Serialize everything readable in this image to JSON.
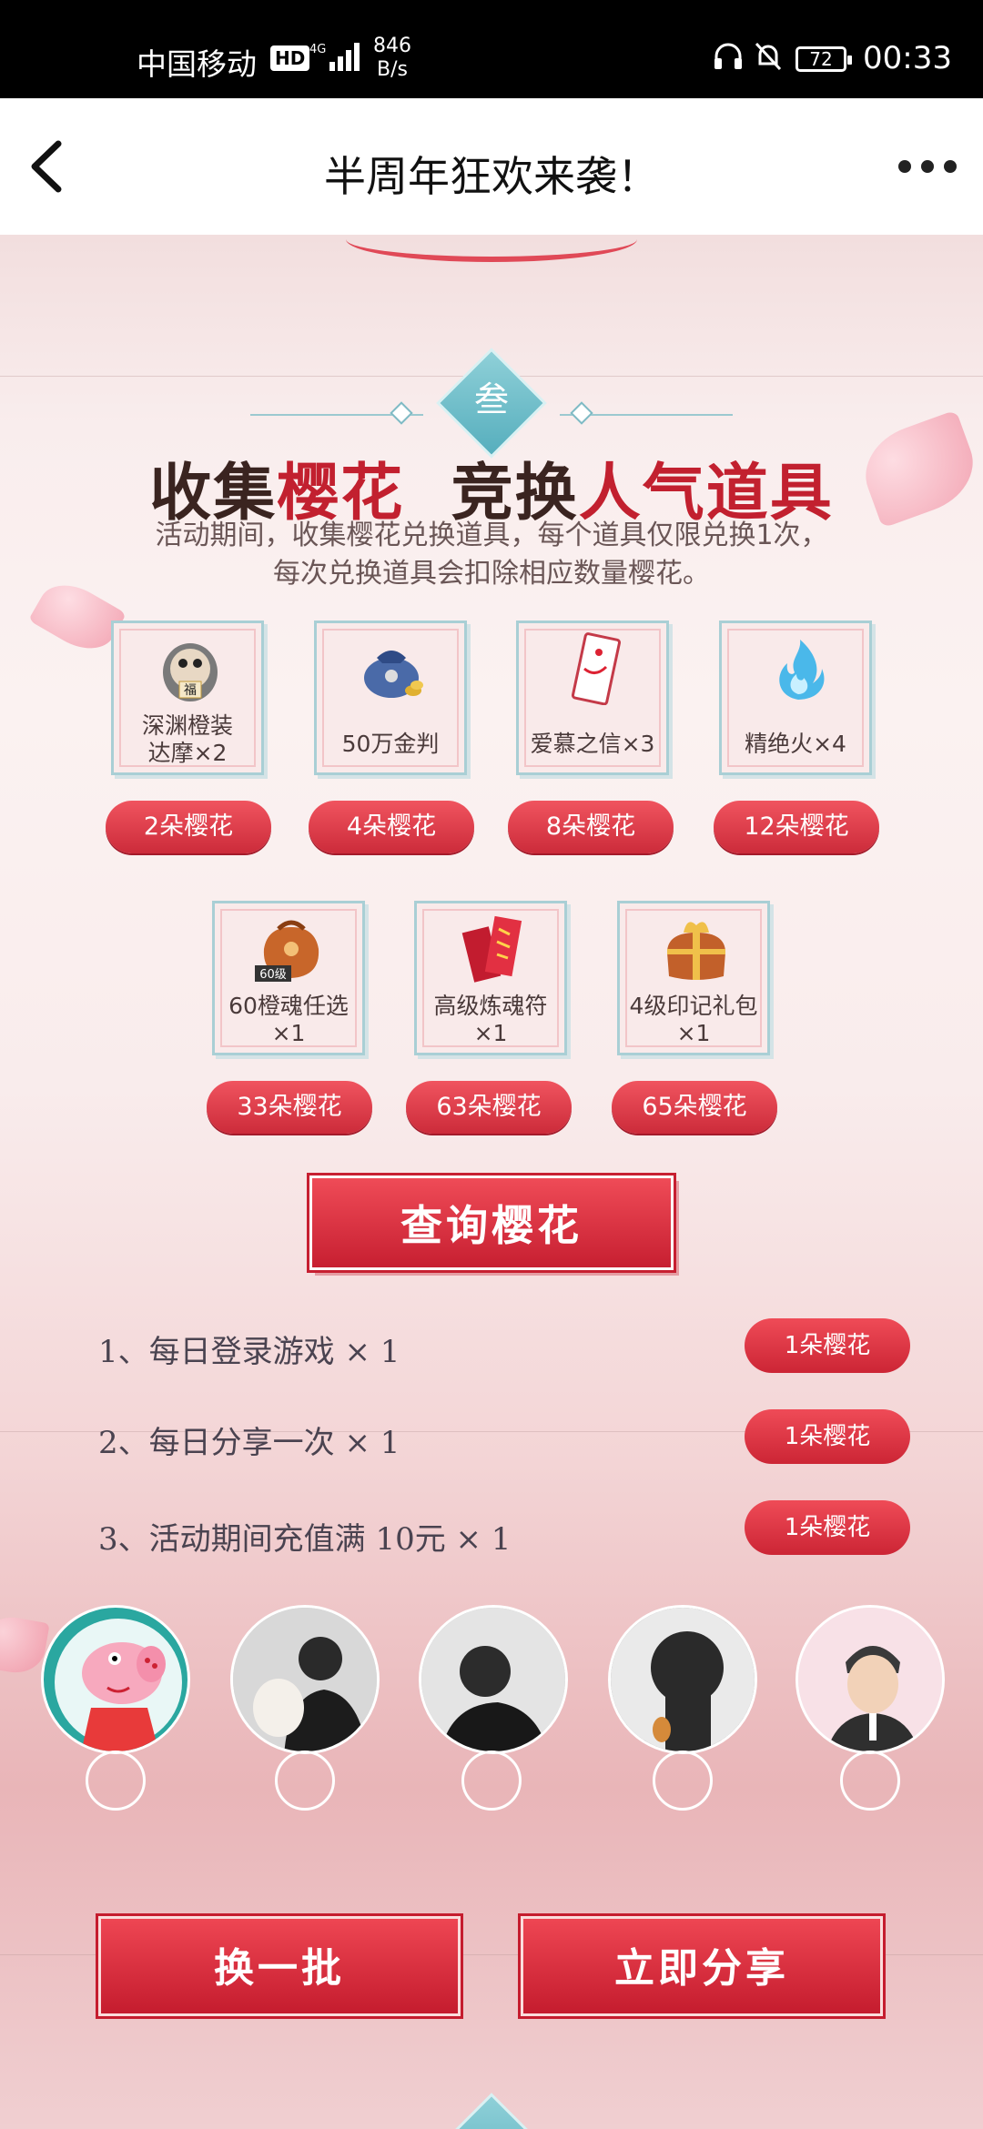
{
  "status_bar": {
    "carrier": "中国移动",
    "hd": "HD",
    "network": "4G",
    "speed_value": "846",
    "speed_unit": "B/s",
    "battery": "72",
    "time": "00:33"
  },
  "header": {
    "title": "半周年狂欢来袭！"
  },
  "section": {
    "badge": "叁",
    "heading_a": "收集",
    "heading_b": "樱花",
    "heading_c": "竞换",
    "heading_d": "人气道具",
    "desc_line1": "活动期间，收集樱花兑换道具，每个道具仅限兑换1次，",
    "desc_line2": "每次兑换道具会扣除相应数量樱花。"
  },
  "rewards": [
    {
      "name_line1": "深渊橙装",
      "name_line2": "达摩×2",
      "cost": "2朵樱花",
      "icon": "daruma-icon"
    },
    {
      "name_line1": "50万金判",
      "name_line2": "",
      "cost": "4朵樱花",
      "icon": "money-bag-icon"
    },
    {
      "name_line1": "爱慕之信×3",
      "name_line2": "",
      "cost": "8朵樱花",
      "icon": "letter-icon"
    },
    {
      "name_line1": "精绝火×4",
      "name_line2": "",
      "cost": "12朵樱花",
      "icon": "blue-fire-icon"
    },
    {
      "name_line1": "60橙魂任选",
      "name_line2": "×1",
      "cost": "33朵樱花",
      "icon": "soul-bag-icon",
      "tag": "60级"
    },
    {
      "name_line1": "高级炼魂符",
      "name_line2": "×1",
      "cost": "63朵樱花",
      "icon": "talisman-icon"
    },
    {
      "name_line1": "4级印记礼包",
      "name_line2": "×1",
      "cost": "65朵樱花",
      "icon": "gift-pack-icon"
    }
  ],
  "query_button": "查询樱花",
  "tasks": [
    {
      "text": "1、每日登录游戏 × 1",
      "reward": "1朵樱花"
    },
    {
      "text": "2、每日分享一次 × 1",
      "reward": "1朵樱花"
    },
    {
      "text": "3、活动期间充值满 10元 × 1",
      "reward": "1朵樱花"
    }
  ],
  "buttons": {
    "refresh": "换一批",
    "share": "立即分享"
  },
  "colors": {
    "accent_red": "#d62d3d",
    "teal": "#6bbcc7"
  }
}
